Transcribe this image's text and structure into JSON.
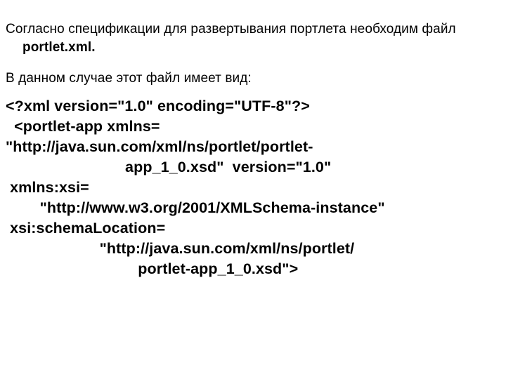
{
  "intro": {
    "line1_prefix": "Согласно спецификации для развертывания портлета необходим файл ",
    "line1_bold": "portlet.xml.",
    "line2": "В данном случае этот файл имеет вид:"
  },
  "code": {
    "l1": "<?xml version=\"1.0\" encoding=\"UTF-8\"?>",
    "l2": "  <portlet-app xmlns=",
    "l3": "\"http://java.sun.com/xml/ns/portlet/portlet-",
    "l4": "                            app_1_0.xsd\"  version=\"1.0\"",
    "l5": " xmlns:xsi=",
    "l6": "        \"http://www.w3.org/2001/XMLSchema-instance\"",
    "l7": " xsi:schemaLocation=",
    "l8": "                      \"http://java.sun.com/xml/ns/portlet/",
    "l9": "                               portlet-app_1_0.xsd\">"
  }
}
